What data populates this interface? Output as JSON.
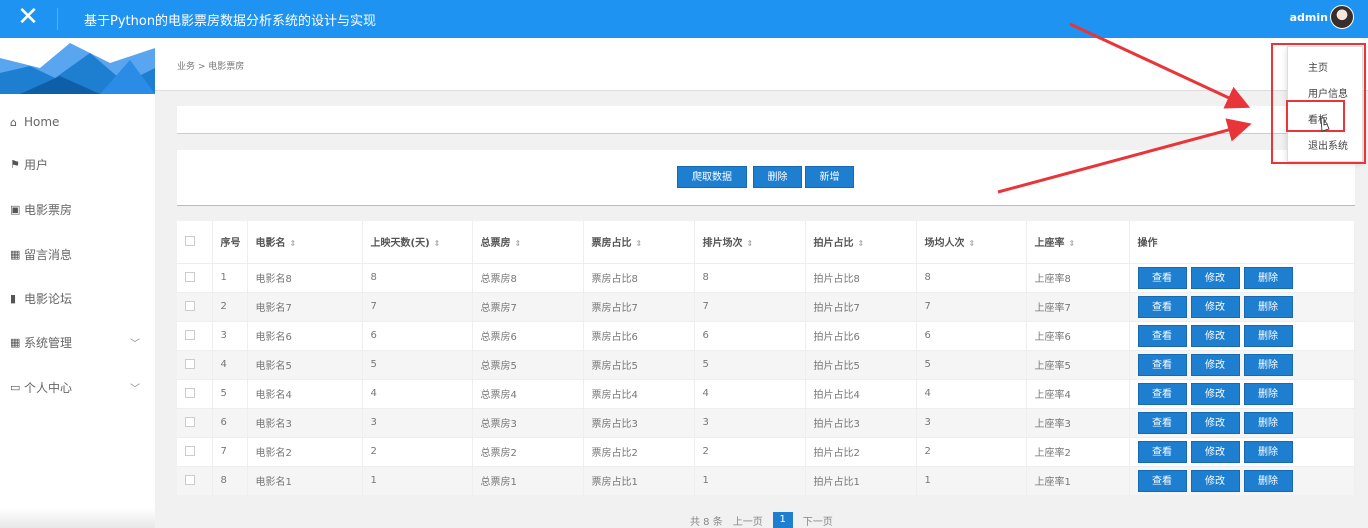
{
  "header": {
    "title": "基于Python的电影票房数据分析系统的设计与实现",
    "user": "admin",
    "close_icon": "✕"
  },
  "sidebar": {
    "items": [
      {
        "label": "Home",
        "icon": "home-icon",
        "glyph": "⌂"
      },
      {
        "label": "用户",
        "icon": "flag-icon",
        "glyph": "⚑"
      },
      {
        "label": "电影票房",
        "icon": "chart-square-icon",
        "glyph": "▣"
      },
      {
        "label": "留言消息",
        "icon": "grid-icon",
        "glyph": "▦"
      },
      {
        "label": "电影论坛",
        "icon": "bar-chart-icon",
        "glyph": "▮"
      },
      {
        "label": "系统管理",
        "icon": "grid-icon",
        "glyph": "▦",
        "expandable": true
      },
      {
        "label": "个人中心",
        "icon": "window-icon",
        "glyph": "▭",
        "expandable": true
      }
    ]
  },
  "breadcrumb": "业务 > 电影票房",
  "actions": {
    "crawl": "爬取数据",
    "delete": "删除",
    "add": "新增"
  },
  "table": {
    "headers": [
      "序号",
      "电影名",
      "上映天数(天)",
      "总票房",
      "票房占比",
      "排片场次",
      "拍片占比",
      "场均人次",
      "上座率",
      "操作"
    ],
    "rows": [
      [
        "1",
        "电影名8",
        "8",
        "总票房8",
        "票房占比8",
        "8",
        "拍片占比8",
        "8",
        "上座率8"
      ],
      [
        "2",
        "电影名7",
        "7",
        "总票房7",
        "票房占比7",
        "7",
        "拍片占比7",
        "7",
        "上座率7"
      ],
      [
        "3",
        "电影名6",
        "6",
        "总票房6",
        "票房占比6",
        "6",
        "拍片占比6",
        "6",
        "上座率6"
      ],
      [
        "4",
        "电影名5",
        "5",
        "总票房5",
        "票房占比5",
        "5",
        "拍片占比5",
        "5",
        "上座率5"
      ],
      [
        "5",
        "电影名4",
        "4",
        "总票房4",
        "票房占比4",
        "4",
        "拍片占比4",
        "4",
        "上座率4"
      ],
      [
        "6",
        "电影名3",
        "3",
        "总票房3",
        "票房占比3",
        "3",
        "拍片占比3",
        "3",
        "上座率3"
      ],
      [
        "7",
        "电影名2",
        "2",
        "总票房2",
        "票房占比2",
        "2",
        "拍片占比2",
        "2",
        "上座率2"
      ],
      [
        "8",
        "电影名1",
        "1",
        "总票房1",
        "票房占比1",
        "1",
        "拍片占比1",
        "1",
        "上座率1"
      ]
    ],
    "row_actions": [
      "查看",
      "修改",
      "删除"
    ]
  },
  "pagination": {
    "total": "共 8 条",
    "prev": "上一页",
    "current": "1",
    "next": "下一页"
  },
  "dropdown": {
    "items": [
      "主页",
      "用户信息",
      "看板",
      "退出系统"
    ]
  },
  "colors": {
    "header": "#1e93f2",
    "button": "#1e7fd1",
    "annotation": "#e8353a"
  }
}
